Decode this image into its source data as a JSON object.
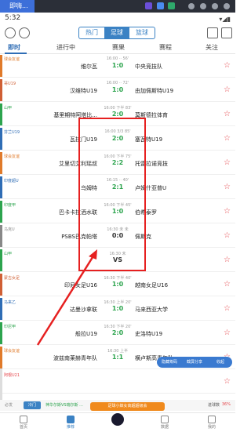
{
  "taskbar": {
    "app_label": "即嗨..."
  },
  "status": {
    "time": "5:32",
    "signal": "▾◢▮"
  },
  "header": {
    "seg": [
      "热门",
      "足球",
      "篮球"
    ],
    "active": 1
  },
  "tabs": [
    "即时",
    "进行中",
    "赛果",
    "赛程",
    "关注"
  ],
  "matches": [
    {
      "league": "球会友谊",
      "lcolor": "#e07a2a",
      "meta": "16:00 ·· 56'",
      "home": "维尔瓦",
      "score": "1:0",
      "away": "中央竞技队",
      "dark": false
    },
    {
      "league": "哥U19",
      "lcolor": "#d05f34",
      "meta": "16:00 ·· 72'",
      "home": "汉维特U19",
      "score": "1:0",
      "away": "由加佩斯特U19",
      "dark": false
    },
    {
      "league": "山甲",
      "lcolor": "#2da44e",
      "meta": "16:00 下半 83'",
      "home": "基里期特阿塔比...",
      "score": "2:0",
      "away": "莫斯德拉体育",
      "dark": false
    },
    {
      "league": "芬兰U19",
      "lcolor": "#2f6db5",
      "meta": "16:00 3/3 85'",
      "home": "瓦拉门U19",
      "score": "2:0",
      "away": "塞瓦特U19",
      "dark": false
    },
    {
      "league": "球会友谊",
      "lcolor": "#e07a2a",
      "meta": "16:00 下半 75'",
      "home": "艾里切艾利瑶叔",
      "score": "2:2",
      "away": "托雷拉诺竞技",
      "dark": false
    },
    {
      "league": "印度超U",
      "lcolor": "#2f6db5",
      "meta": "16:15 ·· 40'",
      "home": "乌姆特",
      "score": "2:1",
      "away": "卢姆什亚普U",
      "dark": false
    },
    {
      "league": "印度甲",
      "lcolor": "#2da44e",
      "meta": "16:00 下半 45'",
      "home": "巴卡卡拉洒水联",
      "score": "1:0",
      "away": "伯希泰罗",
      "dark": false
    },
    {
      "league": "乌克U",
      "lcolor": "#888888",
      "meta": "16:30 未 未",
      "home": "PSBS巴克帕塔",
      "score": "0:0",
      "away": "佩斯克",
      "dark": true
    },
    {
      "league": "山甲",
      "lcolor": "#2da44e",
      "meta": "16:30 未",
      "home": "",
      "score": "VS",
      "away": "",
      "dark": true
    },
    {
      "league": "蒙古女足",
      "lcolor": "#d05f34",
      "meta": "16:30 下半 40'",
      "home": "印尼女足U16",
      "score": "1:0",
      "away": "越南女足U16",
      "dark": false
    },
    {
      "league": "马来乙",
      "lcolor": "#2f6db5",
      "meta": "16:30 上半 20'",
      "home": "达曼沙拿联",
      "score": "1:0",
      "away": "马来西亚大学",
      "dark": false
    },
    {
      "league": "印尼甲",
      "lcolor": "#2da44e",
      "meta": "16:30 下半 20'",
      "home": "般拉U19",
      "score": "2:0",
      "away": "史洛特U19",
      "dark": false
    },
    {
      "league": "球会友谊",
      "lcolor": "#e07a2a",
      "meta": "16:30 上半",
      "home": "波兹南莱赫青年队",
      "score": "1:1",
      "away": "横卢斯高青年队",
      "dark": false
    },
    {
      "league": "阿根U21",
      "lcolor": "#e5484d",
      "meta": "",
      "home": "",
      "score": "",
      "away": "",
      "dark": true
    }
  ],
  "float": {
    "left": "隐藏筹码",
    "mid": "截屏分享",
    "right": "收起"
  },
  "filter": {
    "label": "必发",
    "btn": "冷门",
    "desc": "神华尔斯VS瑞尔斯 ...",
    "pct_label": "进球数",
    "pct": "36%"
  },
  "promo": "足球小妹女高超超级会",
  "nav": [
    "首页",
    "推荐",
    "数据",
    "我的"
  ],
  "colors": {
    "accent": "#3b82c4",
    "live": "#2da44e",
    "highlight": "#e62020"
  }
}
